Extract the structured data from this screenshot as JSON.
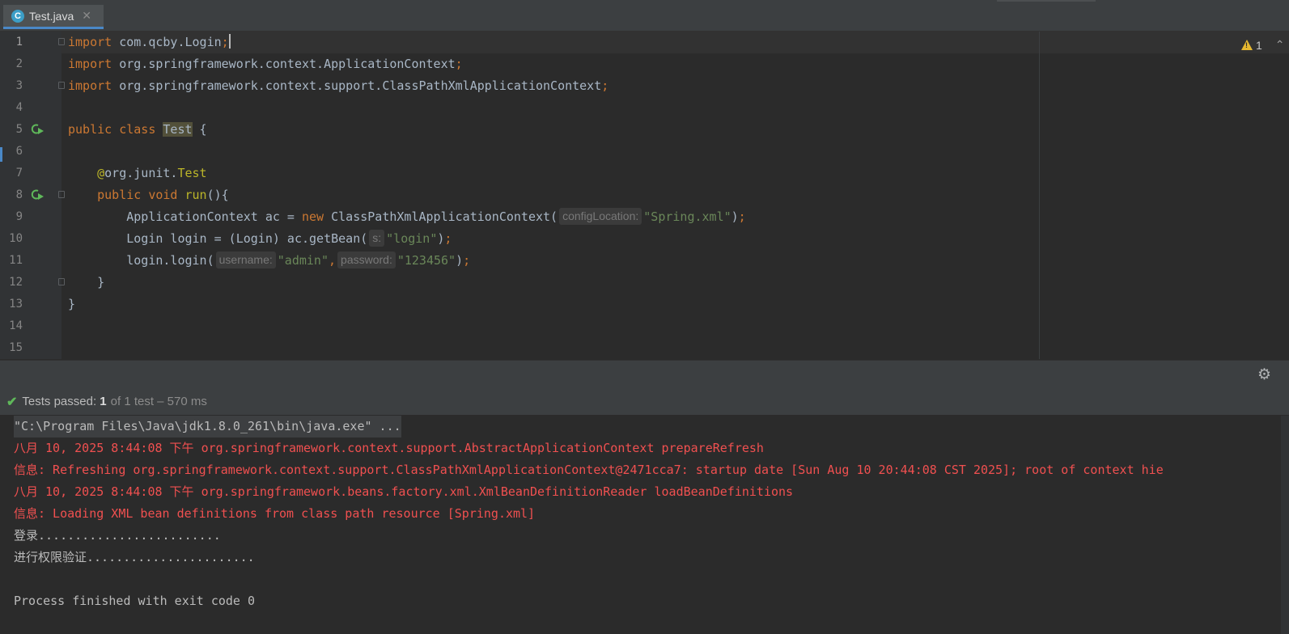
{
  "tab": {
    "icon": "C",
    "label": "Test.java",
    "close": "✕"
  },
  "inspections": {
    "warning_count": "1"
  },
  "editor": {
    "lines": [
      {
        "num": "1",
        "parts": [
          {
            "t": "import",
            "c": "kw"
          },
          {
            "t": " com.qcby.Login",
            "c": "plain"
          },
          {
            "t": ";",
            "c": "kw"
          }
        ]
      },
      {
        "num": "2",
        "parts": [
          {
            "t": "import",
            "c": "kw"
          },
          {
            "t": " org.springframework.context.ApplicationContext",
            "c": "plain"
          },
          {
            "t": ";",
            "c": "kw"
          }
        ]
      },
      {
        "num": "3",
        "parts": [
          {
            "t": "import",
            "c": "kw"
          },
          {
            "t": " org.springframework.context.support.ClassPathXmlApplicationContext",
            "c": "plain"
          },
          {
            "t": ";",
            "c": "kw"
          }
        ]
      },
      {
        "num": "4",
        "parts": []
      },
      {
        "num": "5",
        "parts": [
          {
            "t": "public class ",
            "c": "kw"
          },
          {
            "t": "Test",
            "c": "plain highlight"
          },
          {
            "t": " {",
            "c": "plain"
          }
        ]
      },
      {
        "num": "6",
        "parts": []
      },
      {
        "num": "7",
        "parts": [
          {
            "t": "    ",
            "c": "plain"
          },
          {
            "t": "@",
            "c": "ann"
          },
          {
            "t": "org.junit.",
            "c": "plain"
          },
          {
            "t": "Test",
            "c": "ann"
          }
        ]
      },
      {
        "num": "8",
        "parts": [
          {
            "t": "    ",
            "c": "plain"
          },
          {
            "t": "public void ",
            "c": "kw"
          },
          {
            "t": "run",
            "c": "ann"
          },
          {
            "t": "(){",
            "c": "plain"
          }
        ]
      },
      {
        "num": "9",
        "parts": [
          {
            "t": "        ApplicationContext ac = ",
            "c": "plain"
          },
          {
            "t": "new ",
            "c": "kw"
          },
          {
            "t": "ClassPathXmlApplicationContext(",
            "c": "plain"
          },
          {
            "t": "configLocation:",
            "c": "hint"
          },
          {
            "t": "\"Spring.xml\"",
            "c": "str"
          },
          {
            "t": ")",
            "c": "plain"
          },
          {
            "t": ";",
            "c": "kw"
          }
        ]
      },
      {
        "num": "10",
        "parts": [
          {
            "t": "        Login login = (Login) ac.getBean(",
            "c": "plain"
          },
          {
            "t": "s:",
            "c": "hint"
          },
          {
            "t": "\"login\"",
            "c": "str"
          },
          {
            "t": ")",
            "c": "plain"
          },
          {
            "t": ";",
            "c": "kw"
          }
        ]
      },
      {
        "num": "11",
        "parts": [
          {
            "t": "        login.login(",
            "c": "plain"
          },
          {
            "t": "username:",
            "c": "hint"
          },
          {
            "t": "\"admin\"",
            "c": "str"
          },
          {
            "t": ",",
            "c": "kw"
          },
          {
            "t": "password:",
            "c": "hint"
          },
          {
            "t": "\"123456\"",
            "c": "str"
          },
          {
            "t": ")",
            "c": "plain"
          },
          {
            "t": ";",
            "c": "kw"
          }
        ]
      },
      {
        "num": "12",
        "parts": [
          {
            "t": "    }",
            "c": "plain"
          }
        ]
      },
      {
        "num": "13",
        "parts": [
          {
            "t": "}",
            "c": "plain"
          }
        ]
      },
      {
        "num": "14",
        "parts": []
      },
      {
        "num": "15",
        "parts": []
      }
    ]
  },
  "run": {
    "status_label": "Tests passed: ",
    "status_count": "1",
    "status_summary": "of 1 test – 570 ms"
  },
  "console": [
    {
      "text": "\"C:\\Program Files\\Java\\jdk1.8.0_261\\bin\\java.exe\" ...",
      "kind": "cmd"
    },
    {
      "text": "八月 10, 2025 8:44:08 下午 org.springframework.context.support.AbstractApplicationContext prepareRefresh",
      "kind": "err"
    },
    {
      "text": "信息: Refreshing org.springframework.context.support.ClassPathXmlApplicationContext@2471cca7: startup date [Sun Aug 10 20:44:08 CST 2025]; root of context hie",
      "kind": "err"
    },
    {
      "text": "八月 10, 2025 8:44:08 下午 org.springframework.beans.factory.xml.XmlBeanDefinitionReader loadBeanDefinitions",
      "kind": "err"
    },
    {
      "text": "信息: Loading XML bean definitions from class path resource [Spring.xml]",
      "kind": "err"
    },
    {
      "text": "登录.........................",
      "kind": "out"
    },
    {
      "text": "进行权限验证.......................",
      "kind": "out"
    },
    {
      "text": "",
      "kind": "out"
    },
    {
      "text": "Process finished with exit code 0",
      "kind": "out"
    }
  ]
}
